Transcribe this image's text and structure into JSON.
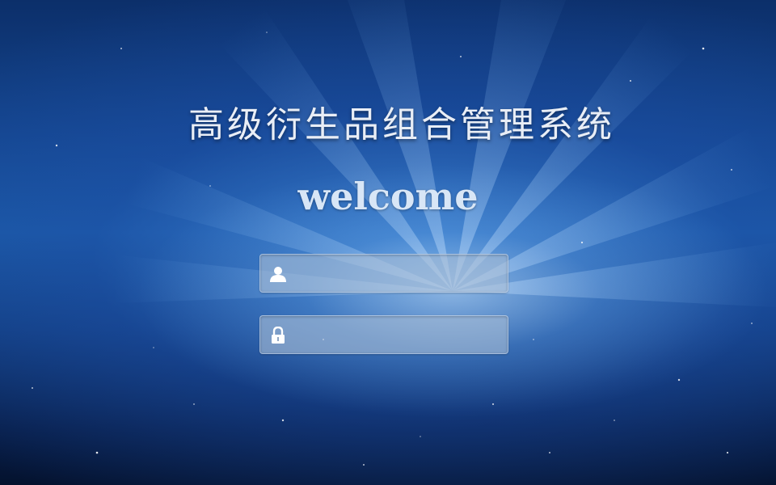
{
  "page": {
    "title": "高级衍生品组合管理系统",
    "subtitle": "welcome"
  },
  "login_form": {
    "username": {
      "icon": "user-icon",
      "value": "",
      "placeholder": ""
    },
    "password": {
      "icon": "lock-icon",
      "value": "",
      "placeholder": ""
    }
  },
  "colors": {
    "background_top": "#0c2f6a",
    "background_mid": "#1b5aa6",
    "background_bottom": "#04122e",
    "title_text": "#e9eef6",
    "field_fill": "#aabed7"
  }
}
